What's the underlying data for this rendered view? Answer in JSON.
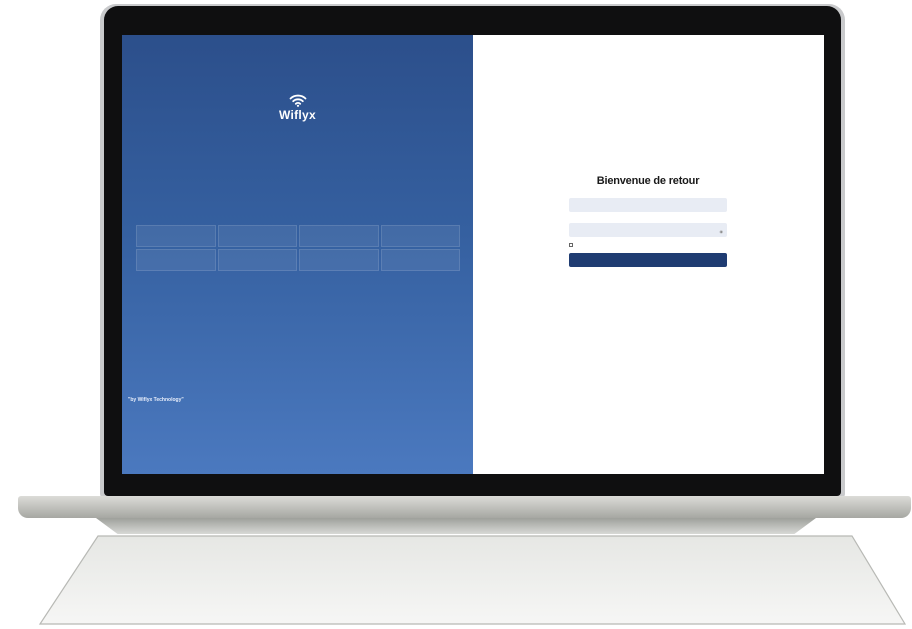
{
  "left": {
    "brand": "Wiflyx",
    "tagline": "",
    "section_title": "",
    "features": [
      {
        "icon": "",
        "label": ""
      },
      {
        "icon": "",
        "label": ""
      },
      {
        "icon": "",
        "label": ""
      },
      {
        "icon": "",
        "label": ""
      },
      {
        "icon": "",
        "label": ""
      },
      {
        "icon": "",
        "label": ""
      },
      {
        "icon": "",
        "label": ""
      },
      {
        "icon": "",
        "label": ""
      }
    ],
    "credit": "\"by Wiflyx Technology\""
  },
  "right": {
    "language": "",
    "title": "Bienvenue de retour",
    "subtitle": "",
    "sublink": "",
    "email_label": "",
    "email_value": "",
    "password_label": "",
    "forgot_label": "",
    "password_value": "",
    "remember_label": "",
    "submit_label": "",
    "terms_text": "",
    "terms_link_1": "",
    "terms_and": "",
    "terms_link_2": ""
  },
  "colors": {
    "panel_blue_top": "#2c4f8b",
    "panel_blue_bottom": "#4b79bf",
    "accent_orange": "#e8a060",
    "button_navy": "#1f3c72",
    "input_bg": "#e8ecf4"
  },
  "icons": {
    "logo": "wifi-icon",
    "password_toggle": "eye-icon",
    "remember": "checkbox-icon"
  }
}
